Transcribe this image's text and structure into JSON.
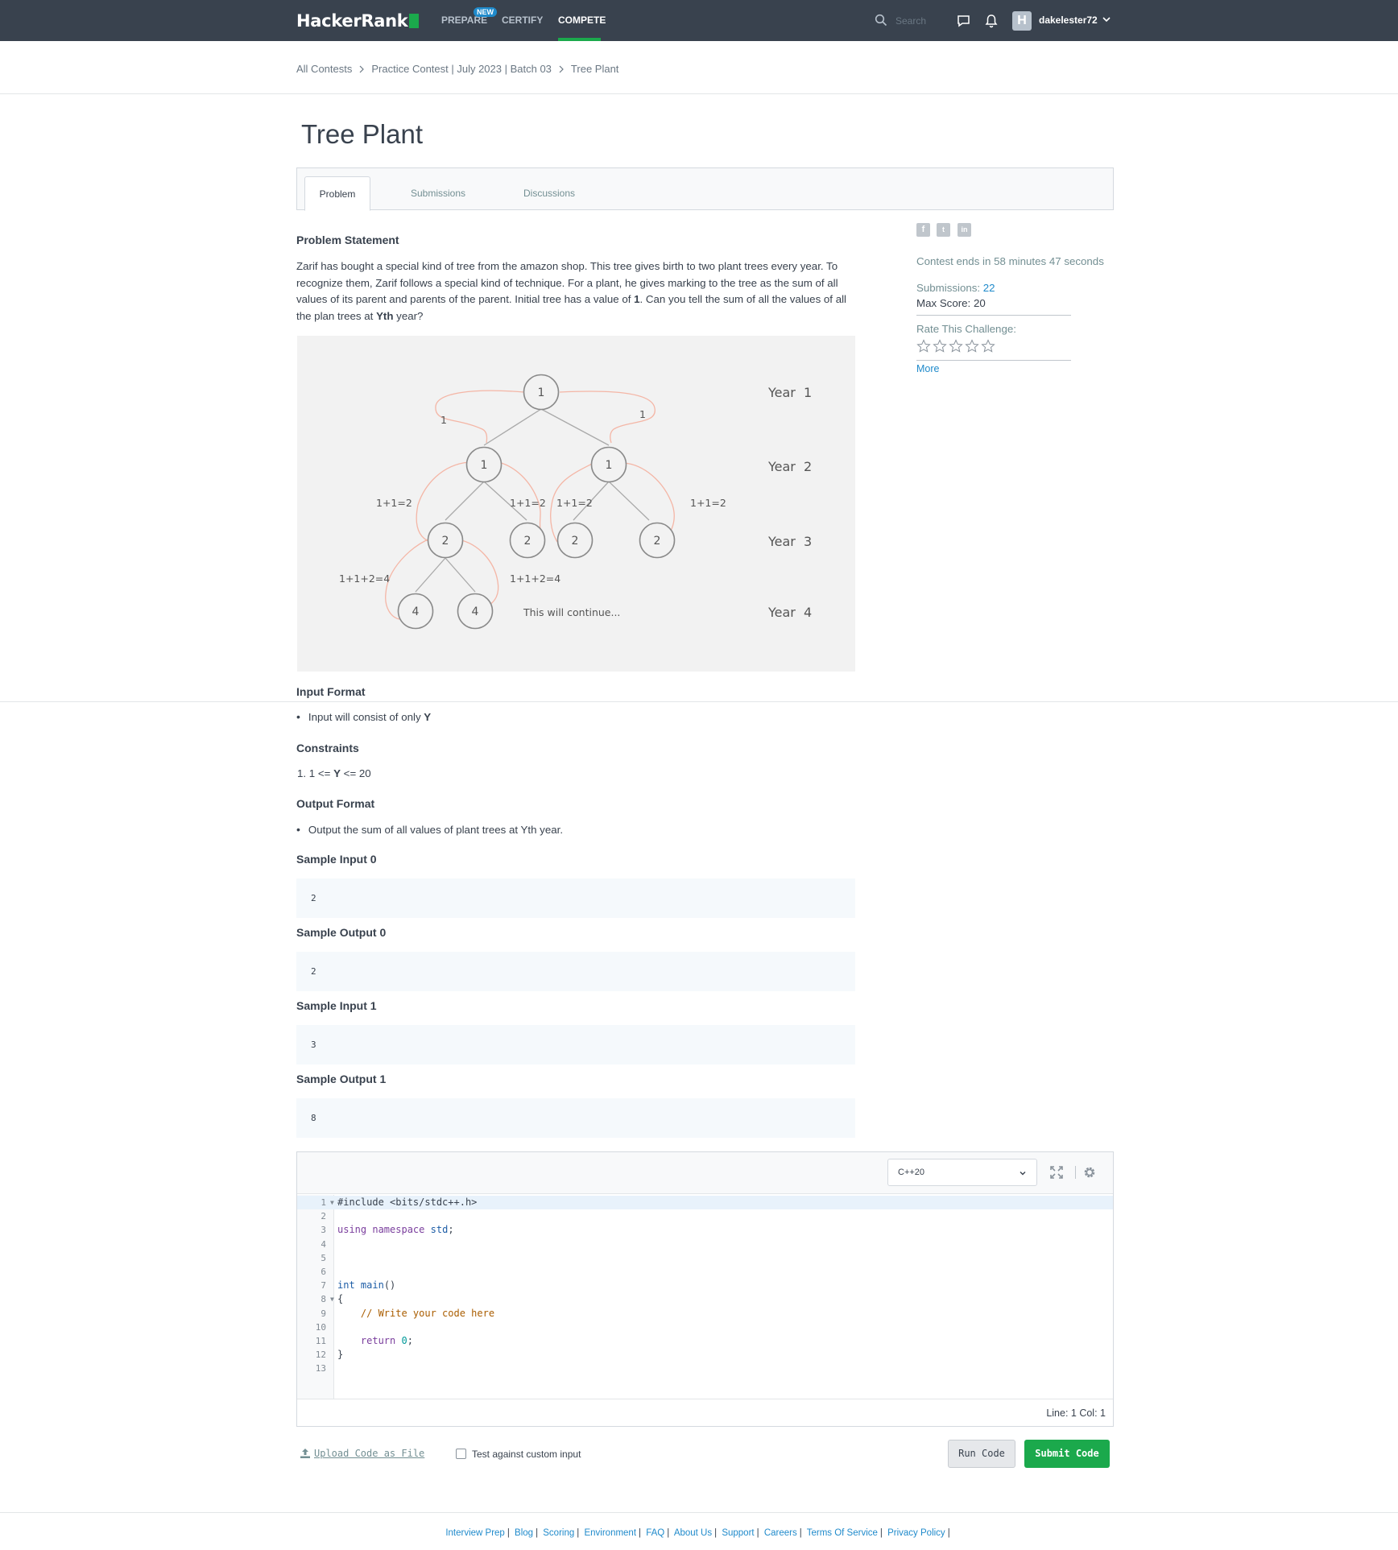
{
  "nav": {
    "logo": "HackerRank",
    "links": [
      "PREPARE",
      "CERTIFY",
      "COMPETE"
    ],
    "new_badge": "NEW",
    "search_placeholder": "Search",
    "avatar_letter": "H",
    "username": "dakelester72"
  },
  "breadcrumb": [
    "All Contests",
    "Practice Contest | July 2023 | Batch 03",
    "Tree Plant"
  ],
  "page_title": "Tree Plant",
  "tabs": [
    "Problem",
    "Submissions",
    "Discussions"
  ],
  "problem": {
    "statement_heading": "Problem Statement",
    "statement_part1": "Zarif has bought a special kind of tree from the amazon shop. This tree gives birth to two plant trees every year. To recognize them, Zarif follows a special kind of technique. For a plant, he gives marking to the tree as the sum of all values of its parent and parents of the parent. Initial tree has a value of ",
    "statement_bold1": "1",
    "statement_part2": ". Can you tell the sum of all the values of all the plan trees at ",
    "statement_bold2": "Yth",
    "statement_part3": " year?",
    "figure": {
      "nodes": [
        "1",
        "1",
        "1",
        "2",
        "2",
        "2",
        "2",
        "4",
        "4"
      ],
      "edge_labels": [
        "1",
        "1",
        "1+1=2",
        "1+1=2",
        "1+1=2",
        "1+1=2",
        "1+1+2=4",
        "1+1+2=4"
      ],
      "years": [
        "Year  1",
        "Year  2",
        "Year  3",
        "Year  4"
      ],
      "continue_note": "This will continue..."
    },
    "input_heading": "Input Format",
    "input_text": "Input will consist of only ",
    "input_bold": "Y",
    "constraints_heading": "Constraints",
    "constraints_prefix": "1. 1 <= ",
    "constraints_bold": "Y",
    "constraints_suffix": " <= 20",
    "output_heading": "Output Format",
    "output_text": "Output the sum of all values of plant trees at Yth year.",
    "samples": [
      {
        "label": "Sample Input 0",
        "value": "2"
      },
      {
        "label": "Sample Output 0",
        "value": "2"
      },
      {
        "label": "Sample Input 1",
        "value": "3"
      },
      {
        "label": "Sample Output 1",
        "value": "8"
      }
    ]
  },
  "sidebar": {
    "share_icons": [
      "f",
      "t",
      "in"
    ],
    "contest_ends": "Contest ends in 58 minutes 47 seconds",
    "submissions_label": "Submissions: ",
    "submissions_value": "22",
    "max_score": "Max Score: 20",
    "rate_label": "Rate This Challenge:",
    "rating": 0,
    "more": "More"
  },
  "editor": {
    "language": "C++20",
    "lines": [
      "#include <bits/stdc++.h>",
      "",
      "using namespace std;",
      "",
      "",
      "",
      "int main()",
      "{",
      "    // Write your code here",
      "",
      "    return 0;",
      "}",
      ""
    ],
    "line_numbers": [
      "1",
      "2",
      "3",
      "4",
      "5",
      "6",
      "7",
      "8",
      "9",
      "10",
      "11",
      "12",
      "13"
    ],
    "status": "Line: 1 Col: 1"
  },
  "actions": {
    "upload": "Upload Code as File",
    "custom_input": "Test against custom input",
    "run": "Run Code",
    "submit": "Submit Code"
  },
  "footer": [
    "Interview Prep",
    "Blog",
    "Scoring",
    "Environment",
    "FAQ",
    "About Us",
    "Support",
    "Careers",
    "Terms Of Service",
    "Privacy Policy"
  ],
  "colors": {
    "nav_bg": "#39424e",
    "accent_green": "#1ba94c",
    "link_blue": "#1f8acb",
    "figure_curve": "#f4b6a6"
  }
}
